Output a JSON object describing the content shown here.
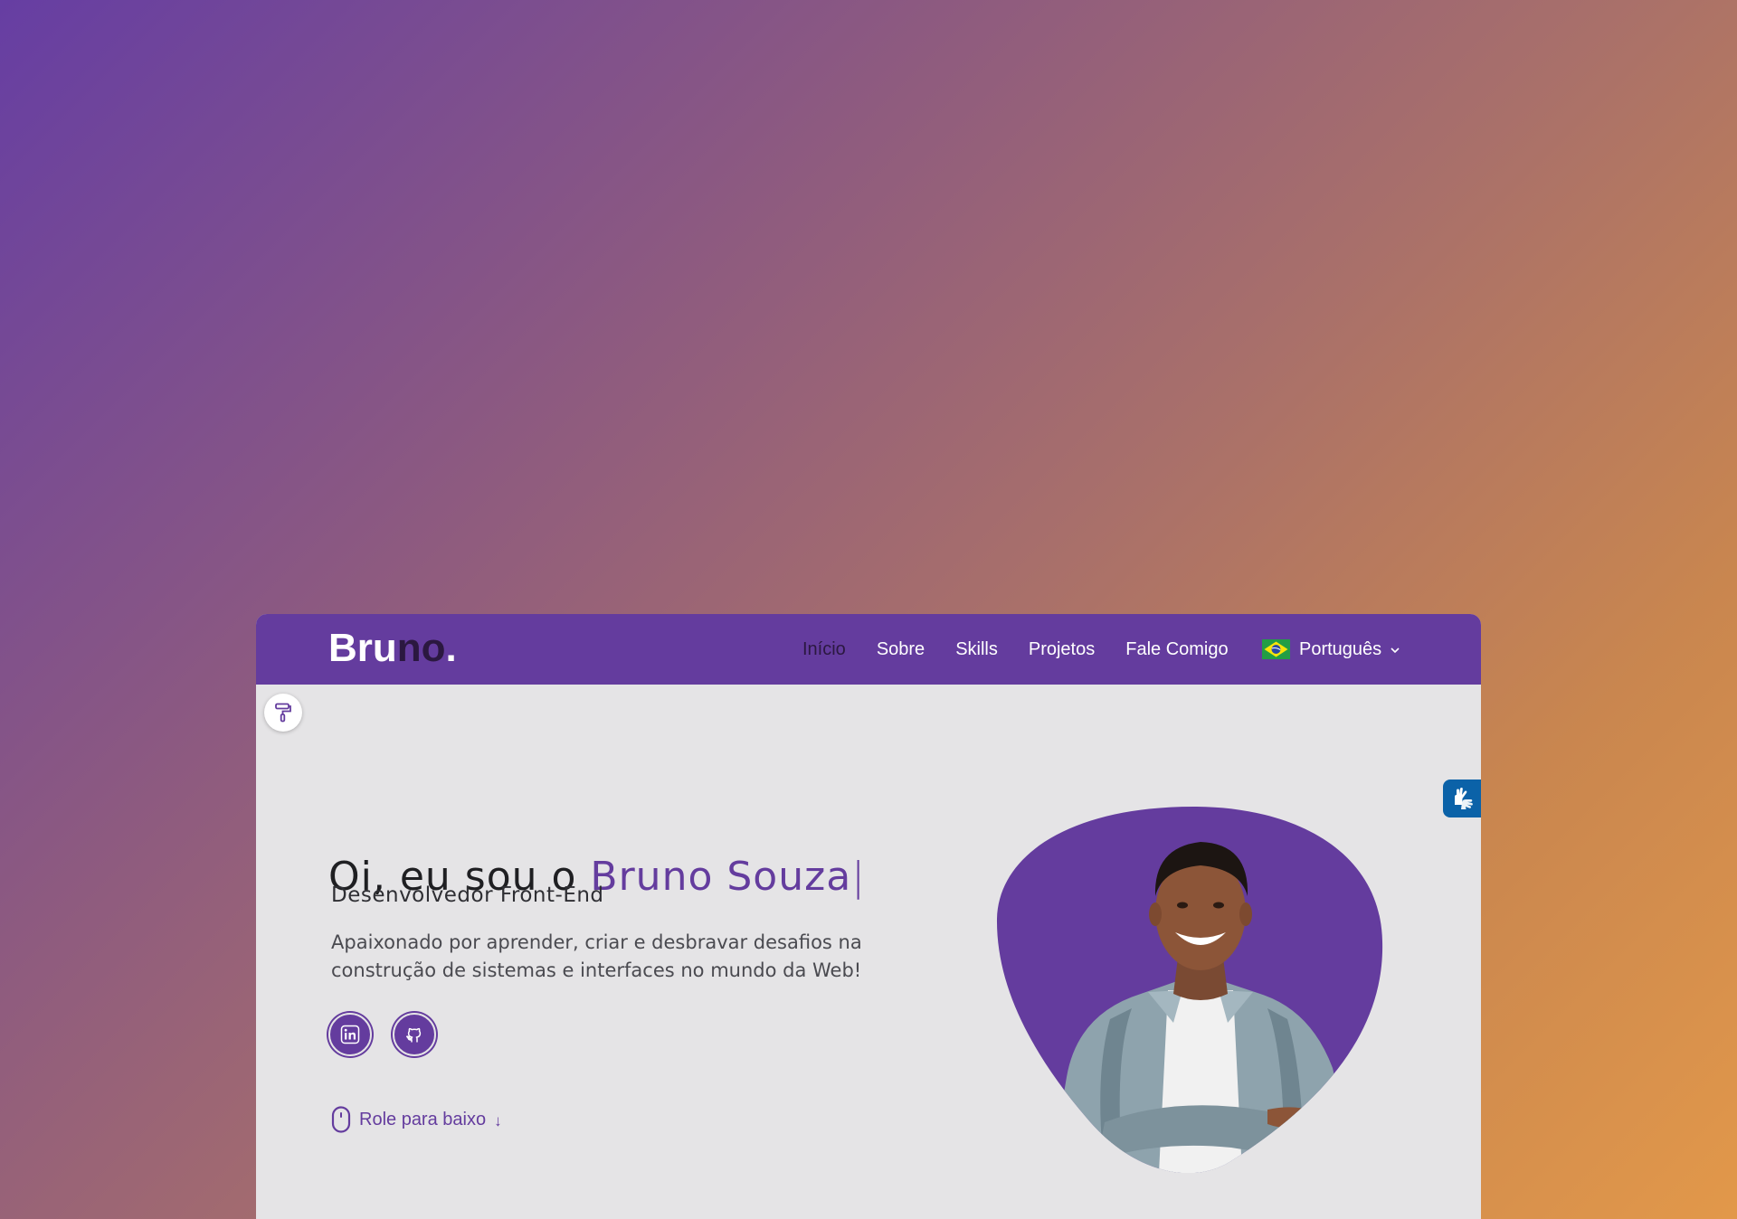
{
  "navbar": {
    "logo": {
      "part1": "Bru",
      "part2": "no",
      "dot": "."
    },
    "links": [
      {
        "label": "Início",
        "active": true
      },
      {
        "label": "Sobre"
      },
      {
        "label": "Skills"
      },
      {
        "label": "Projetos"
      },
      {
        "label": "Fale Comigo"
      }
    ],
    "language": {
      "label": "Português",
      "flag": "brazil-flag-icon"
    }
  },
  "hero": {
    "greeting": "Oi, eu sou o ",
    "name": "Bruno Souza",
    "caret": "|",
    "role": "Desenvolvedor Front-End",
    "description": "Apaixonado por aprender, criar e desbravar desafios na construção de sistemas e interfaces no mundo da Web!",
    "social": [
      {
        "name": "linkedin-icon"
      },
      {
        "name": "github-icon"
      }
    ],
    "scroll_label": "Role para baixo",
    "scroll_arrow": "↓"
  },
  "colors": {
    "accent": "#643c9e",
    "dark_accent": "#2b1840",
    "content_bg": "#e5e4e6",
    "vlibras": "#0b62a8"
  },
  "icons": {
    "theme": "paint-roller-icon",
    "accessibility": "sign-language-hands-icon",
    "scroll": "mouse-icon"
  }
}
